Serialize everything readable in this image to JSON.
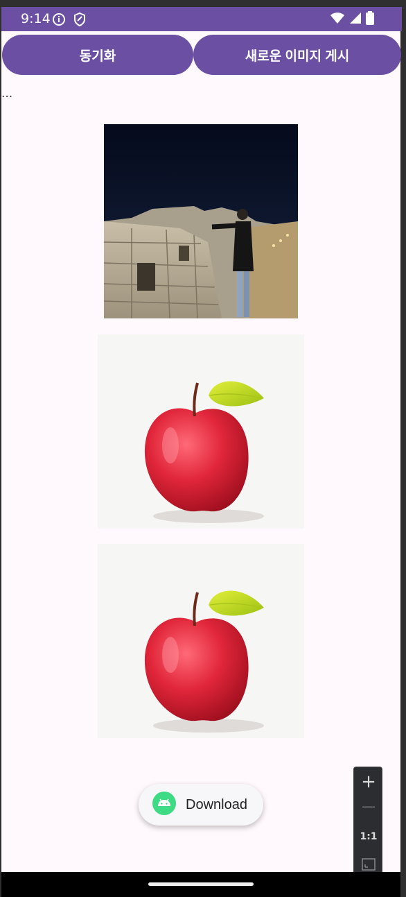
{
  "status_bar": {
    "time": "9:14"
  },
  "buttons": {
    "sync_label": "동기화",
    "new_image_label": "새로운 이미지 게시"
  },
  "loading_text": "...",
  "images": [
    {
      "description_icon": "night-fortress-photo"
    },
    {
      "description_icon": "red-apple-photo"
    },
    {
      "description_icon": "red-apple-photo"
    }
  ],
  "toast": {
    "label": "Download"
  },
  "zoom_controls": {
    "plus": "+",
    "minus": "—",
    "reset": "1:1"
  },
  "colors": {
    "accent": "#6b4fa3",
    "background": "#fff8fc"
  }
}
